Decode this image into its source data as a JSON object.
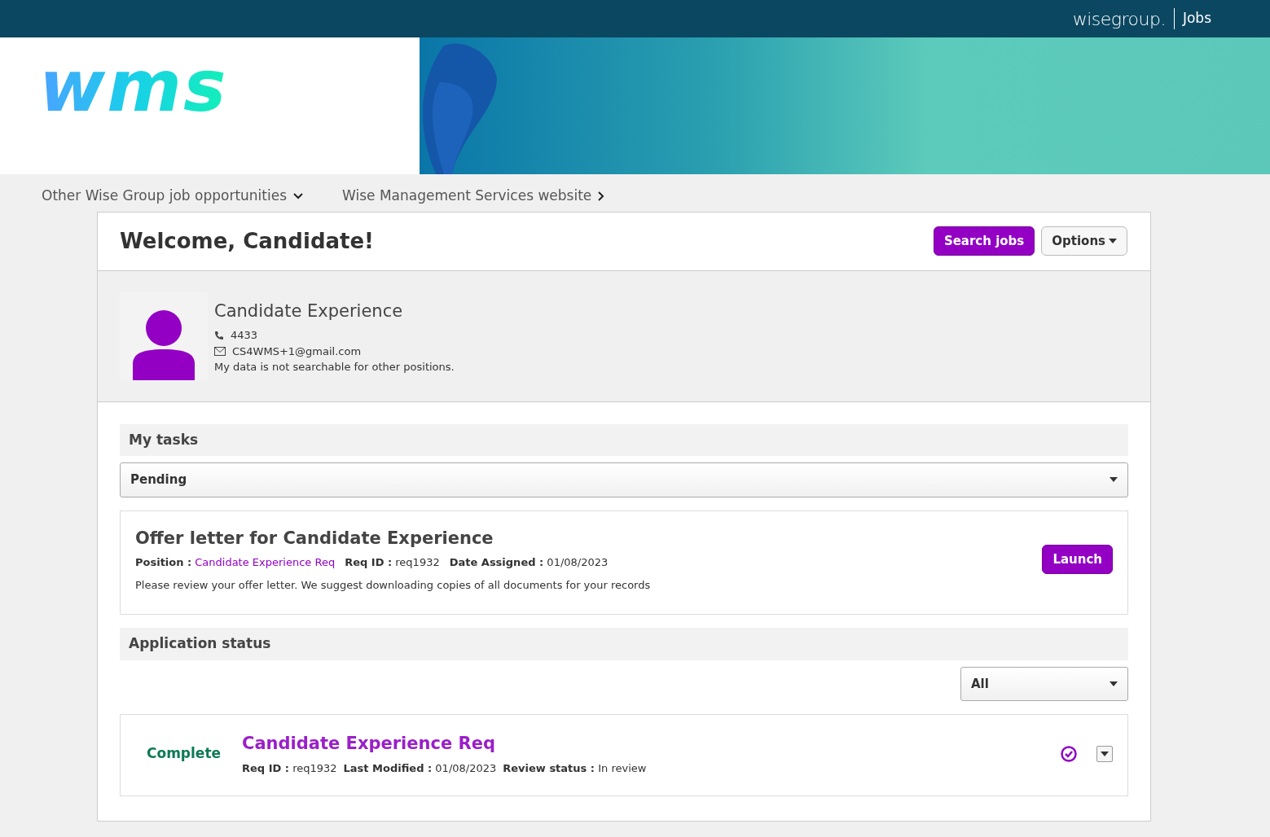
{
  "top_bar": {
    "brand": "wisegroup.",
    "section": "Jobs"
  },
  "banner": {
    "logo": "wms"
  },
  "nav_links": [
    {
      "label": "Other Wise Group job opportunities",
      "kind": "dropdown"
    },
    {
      "label": "Wise Management Services website",
      "kind": "link"
    }
  ],
  "welcome": {
    "title": "Welcome, Candidate!",
    "buttons": [
      {
        "label": "Search jobs",
        "kind": "primary"
      },
      {
        "label": "Options",
        "kind": "dropdown"
      }
    ]
  },
  "profile": {
    "name": "Candidate Experience",
    "phone": "4433",
    "email": "CS4WMS+1@gmail.com",
    "note": "My data is not searchable for other positions."
  },
  "tasks": {
    "heading": "My tasks",
    "filter": "Pending",
    "items": [
      {
        "title": "Offer letter for Candidate Experience",
        "position_label": "Position :",
        "position": "Candidate Experience Req",
        "fields": [
          "**Req ID :** req1932",
          "**Date Assigned :** 01/08/2023"
        ],
        "description": "Please review your offer letter. We suggest downloading copies of all documents for your records",
        "action": "Launch"
      }
    ]
  },
  "applications": {
    "heading": "Application status",
    "filter": "All",
    "items": [
      {
        "status": "Complete",
        "title": "Candidate Experience Req",
        "fields": [
          "**Req ID :** req1932",
          "**Last Modified :** 01/08/2023",
          "**Review status :** In review"
        ],
        "complete": true
      }
    ]
  }
}
